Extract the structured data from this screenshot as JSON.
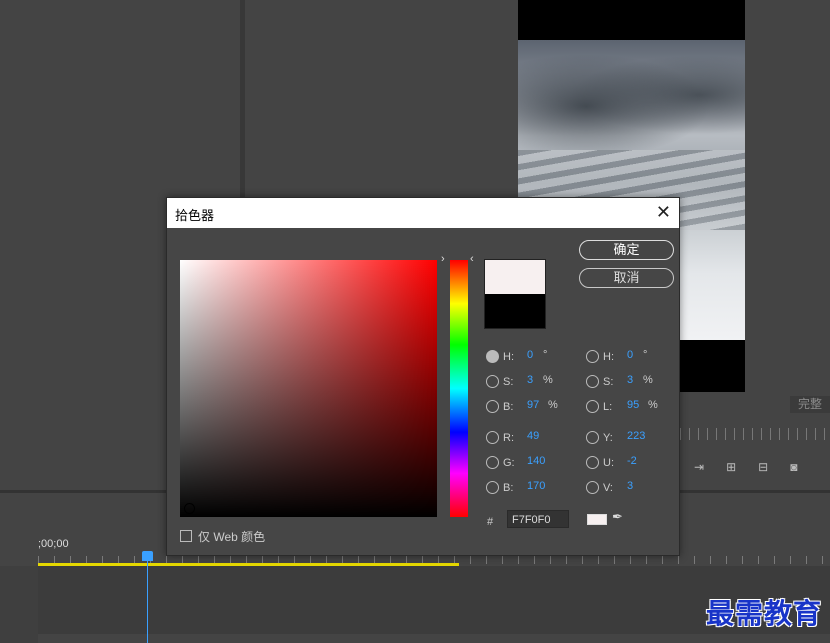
{
  "background": {
    "done_label": "完整",
    "timecode": ";00;00",
    "watermark": "最需教育"
  },
  "dialog": {
    "title": "拾色器",
    "ok": "确定",
    "cancel": "取消",
    "hex_hash": "#",
    "hex_value": "F7F0F0",
    "web_only_label": "仅 Web 颜色",
    "colors": {
      "current": "#F7F0F0",
      "previous": "#000000"
    },
    "left_fields": [
      {
        "label": "H:",
        "value": "0",
        "unit": "°",
        "selected": true
      },
      {
        "label": "S:",
        "value": "3",
        "unit": "%",
        "selected": false
      },
      {
        "label": "B:",
        "value": "97",
        "unit": "%",
        "selected": false
      },
      {
        "label": "R:",
        "value": "49",
        "unit": "",
        "selected": false
      },
      {
        "label": "G:",
        "value": "140",
        "unit": "",
        "selected": false
      },
      {
        "label": "B:",
        "value": "170",
        "unit": "",
        "selected": false
      }
    ],
    "right_fields": [
      {
        "label": "H:",
        "value": "0",
        "unit": "°",
        "selected": false
      },
      {
        "label": "S:",
        "value": "3",
        "unit": "%",
        "selected": false
      },
      {
        "label": "L:",
        "value": "95",
        "unit": "%",
        "selected": false
      },
      {
        "label": "Y:",
        "value": "223",
        "unit": "",
        "selected": false
      },
      {
        "label": "U:",
        "value": "-2",
        "unit": "",
        "selected": false
      },
      {
        "label": "V:",
        "value": "3",
        "unit": "",
        "selected": false
      }
    ]
  }
}
